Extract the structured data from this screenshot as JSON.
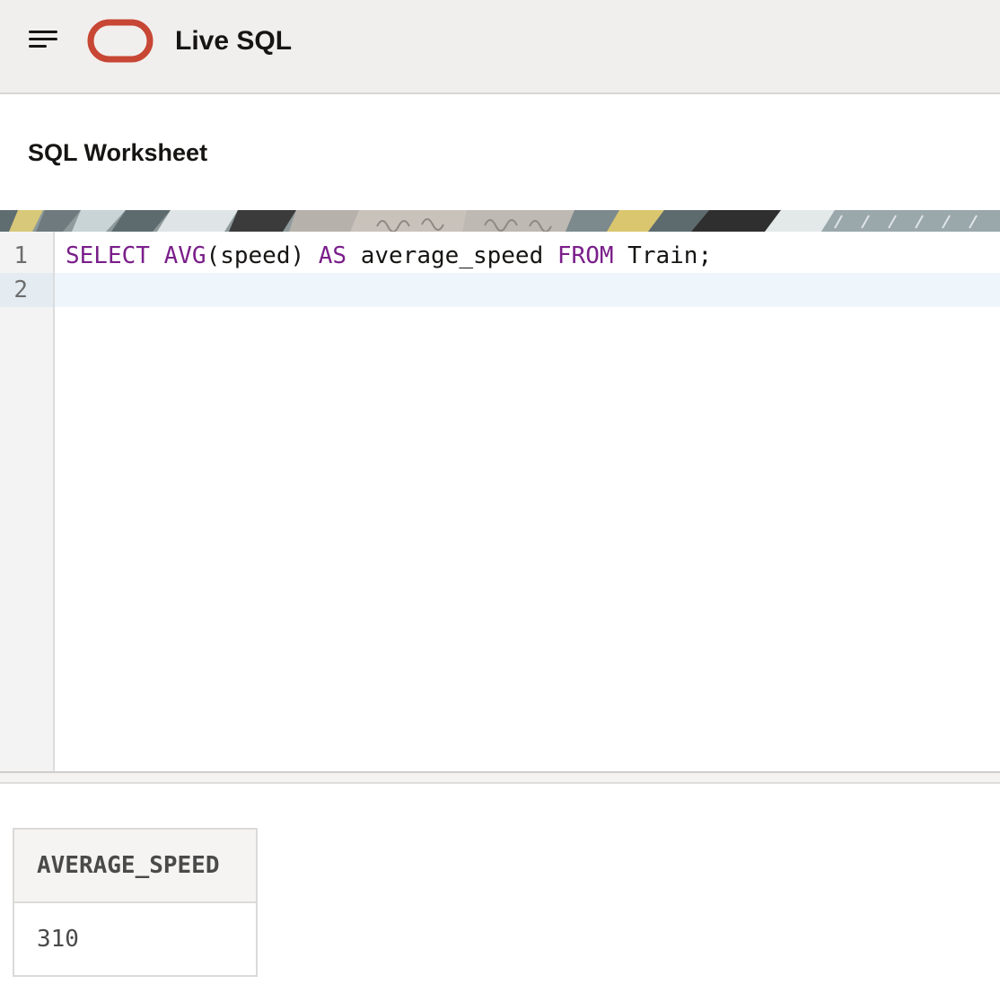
{
  "header": {
    "menu_icon": "hamburger-menu-icon",
    "logo_icon": "oracle-logo-icon",
    "title": "Live SQL",
    "background": "#f1efed",
    "logo_color": "#c74634"
  },
  "worksheet": {
    "title": "SQL Worksheet"
  },
  "editor": {
    "line_numbers": [
      "1",
      "2"
    ],
    "lines": [
      {
        "tokens": [
          {
            "text": "SELECT",
            "type": "keyword"
          },
          {
            "text": " ",
            "type": "plain"
          },
          {
            "text": "AVG",
            "type": "function"
          },
          {
            "text": "(speed) ",
            "type": "plain"
          },
          {
            "text": "AS",
            "type": "keyword"
          },
          {
            "text": " average_speed ",
            "type": "plain"
          },
          {
            "text": "FROM",
            "type": "keyword"
          },
          {
            "text": " Train;",
            "type": "plain"
          }
        ]
      },
      {
        "tokens": []
      }
    ],
    "keyword_color": "#7a1f8a"
  },
  "results": {
    "columns": [
      "AVERAGE_SPEED"
    ],
    "rows": [
      [
        "310"
      ]
    ]
  }
}
